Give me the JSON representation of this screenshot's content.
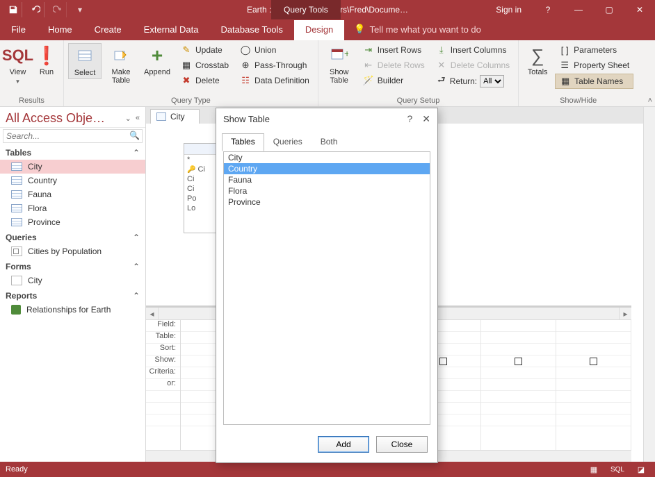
{
  "titlebar": {
    "path": "Earth : Database- C:\\Users\\Fred\\Docume…",
    "contextTab": "Query Tools",
    "signin": "Sign in"
  },
  "tabs": {
    "file": "File",
    "home": "Home",
    "create": "Create",
    "external": "External Data",
    "dbtools": "Database Tools",
    "design": "Design",
    "tellme": "Tell me what you want to do"
  },
  "ribbon": {
    "results": {
      "view": "View",
      "run": "Run",
      "label": "Results"
    },
    "qtype": {
      "select": "Select",
      "make": "Make\nTable",
      "append": "Append",
      "update": "Update",
      "crosstab": "Crosstab",
      "delete": "Delete",
      "union": "Union",
      "passthrough": "Pass-Through",
      "datadef": "Data Definition",
      "label": "Query Type"
    },
    "qsetup": {
      "showtable": "Show\nTable",
      "insertrows": "Insert Rows",
      "deleterows": "Delete Rows",
      "builder": "Builder",
      "insertcols": "Insert Columns",
      "deletecols": "Delete Columns",
      "return": "Return:",
      "returnval": "All",
      "label": "Query Setup"
    },
    "showhide": {
      "totals": "Totals",
      "params": "Parameters",
      "propsheet": "Property Sheet",
      "tablenames": "Table Names",
      "label": "Show/Hide"
    }
  },
  "nav": {
    "title": "All Access Obje…",
    "searchPlaceholder": "Search...",
    "groups": {
      "tables": "Tables",
      "queries": "Queries",
      "forms": "Forms",
      "reports": "Reports"
    },
    "tables": [
      "City",
      "Country",
      "Fauna",
      "Flora",
      "Province"
    ],
    "queriesItems": [
      "Cities by Population"
    ],
    "formsItems": [
      "City"
    ],
    "reportsItems": [
      "Relationships for Earth"
    ]
  },
  "doc": {
    "tab": "City",
    "card": {
      "star": "*",
      "rows": [
        "Ci",
        "Ci",
        "Ci",
        "Po",
        "Lo"
      ]
    },
    "gridRows": [
      "Field:",
      "Table:",
      "Sort:",
      "Show:",
      "Criteria:",
      "or:"
    ]
  },
  "dialog": {
    "title": "Show Table",
    "tabs": {
      "tables": "Tables",
      "queries": "Queries",
      "both": "Both"
    },
    "list": [
      "City",
      "Country",
      "Fauna",
      "Flora",
      "Province"
    ],
    "selected": "Country",
    "add": "Add",
    "close": "Close"
  },
  "status": {
    "ready": "Ready",
    "sql": "SQL"
  }
}
